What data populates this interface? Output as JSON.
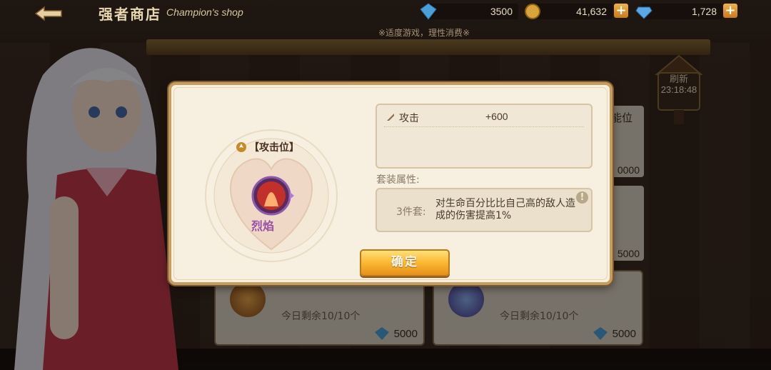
{
  "topbar": {
    "title_cn": "强者商店",
    "title_en": "Champion's shop",
    "currencies": [
      {
        "icon": "crystal-icon",
        "value": "3500"
      },
      {
        "icon": "gold-coin-icon",
        "value": "41,632"
      },
      {
        "icon": "diamond-icon",
        "value": "1,728"
      }
    ],
    "plus_label": "+",
    "notice": "※适度游戏，理性消费※"
  },
  "refresh": {
    "label": "刷新",
    "time": "23:18:48"
  },
  "shop_items": [
    {
      "remaining": "今日剩余10/10个",
      "price": "5000"
    },
    {
      "remaining": "今日剩余10/10个",
      "price": "5000"
    }
  ],
  "side_prices": [
    "0000",
    "5000"
  ],
  "side_label_partial": "能位",
  "dialog": {
    "position_label": "【攻击位】",
    "item_name": "烈焰",
    "stat": {
      "name": "攻击",
      "value": "+600"
    },
    "set_title": "套装属性:",
    "set_count": "3件套:",
    "set_desc": "对生命百分比比自己高的敌人造成的伤害提高1%",
    "info": "!",
    "confirm_label": "确定"
  },
  "colors": {
    "dialog_bg": "#f7efdf",
    "dialog_border": "#c69d5f",
    "confirm_gold": "#fbb730",
    "item_name_purple": "#9a4fa8"
  }
}
